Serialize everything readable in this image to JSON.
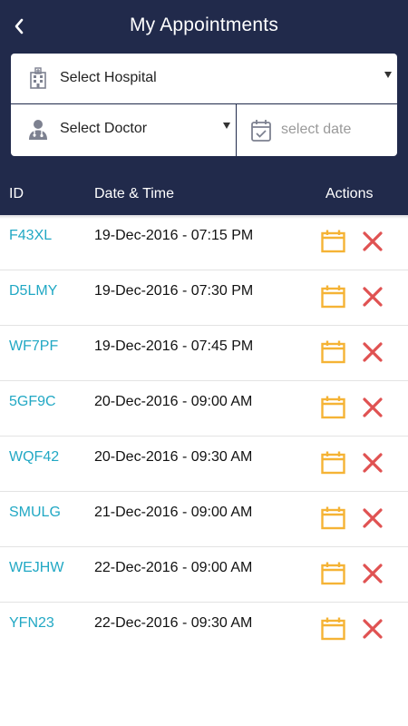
{
  "header": {
    "title": "My Appointments",
    "background_color": "#212a4b"
  },
  "filters": {
    "hospital_label": "Select Hospital",
    "doctor_label": "Select Doctor",
    "date_placeholder": "select date"
  },
  "table": {
    "columns": {
      "id": "ID",
      "datetime": "Date & Time",
      "actions": "Actions"
    },
    "rows": [
      {
        "id": "F43XL",
        "datetime": "19-Dec-2016 - 07:15 PM"
      },
      {
        "id": "D5LMY",
        "datetime": "19-Dec-2016 - 07:30 PM"
      },
      {
        "id": "WF7PF",
        "datetime": "19-Dec-2016 - 07:45 PM"
      },
      {
        "id": "5GF9C",
        "datetime": "20-Dec-2016 - 09:00 AM"
      },
      {
        "id": "WQF42",
        "datetime": "20-Dec-2016 - 09:30 AM"
      },
      {
        "id": "SMULG",
        "datetime": "21-Dec-2016 - 09:00 AM"
      },
      {
        "id": "WEJHW",
        "datetime": "22-Dec-2016 - 09:00 AM"
      },
      {
        "id": "YFN23",
        "datetime": "22-Dec-2016 - 09:30 AM"
      }
    ]
  },
  "icons": {
    "back": "chevron-left-icon",
    "hospital": "hospital-building-icon",
    "doctor": "doctor-icon",
    "date": "calendar-check-icon",
    "reschedule": "calendar-icon",
    "cancel": "close-icon"
  },
  "colors": {
    "id_link": "#21a8c4",
    "calendar_action": "#f5b335",
    "cancel_action": "#e05252"
  }
}
